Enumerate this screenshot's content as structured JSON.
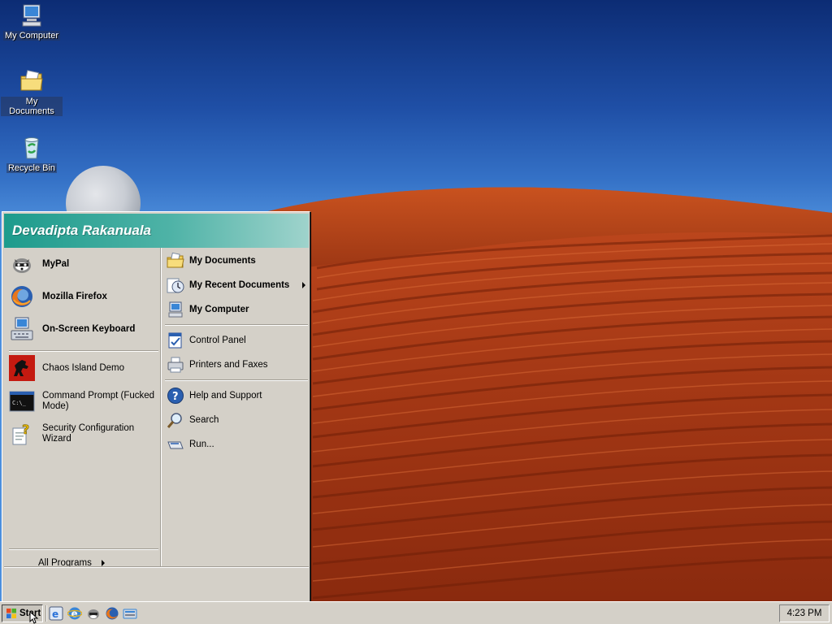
{
  "desktop": {
    "icons": [
      {
        "label": "My Computer",
        "icon": "my-computer-icon"
      },
      {
        "label": "My Documents",
        "icon": "my-documents-icon"
      },
      {
        "label": "Recycle Bin",
        "icon": "recycle-bin-icon"
      }
    ]
  },
  "start_menu": {
    "user_name": "Devadipta Rakanuala",
    "pinned": [
      {
        "label": "MyPal",
        "icon": "mypal-icon"
      },
      {
        "label": "Mozilla Firefox",
        "icon": "firefox-icon"
      },
      {
        "label": "On-Screen Keyboard",
        "icon": "on-screen-keyboard-icon"
      }
    ],
    "recent": [
      {
        "label": "Chaos Island Demo",
        "icon": "chaos-island-icon"
      },
      {
        "label": "Command Prompt (Fucked Mode)",
        "icon": "command-prompt-icon"
      },
      {
        "label": "Security Configuration Wizard",
        "icon": "security-wizard-icon"
      }
    ],
    "all_programs": "All Programs",
    "places": [
      {
        "label": "My Documents",
        "icon": "my-documents-icon"
      },
      {
        "label": "My Recent Documents",
        "icon": "recent-documents-icon"
      },
      {
        "label": "My Computer",
        "icon": "my-computer-icon"
      }
    ],
    "settings": [
      {
        "label": "Control Panel",
        "icon": "control-panel-icon"
      },
      {
        "label": "Printers and Faxes",
        "icon": "printers-icon"
      }
    ],
    "tools": [
      {
        "label": "Help and Support",
        "icon": "help-icon"
      },
      {
        "label": "Search",
        "icon": "search-icon"
      },
      {
        "label": "Run...",
        "icon": "run-icon"
      }
    ]
  },
  "taskbar": {
    "start_label": "Start",
    "quick_launch": [
      "ie-icon",
      "ie-icon",
      "mypal-icon",
      "firefox-icon",
      "keyboard-icon"
    ],
    "clock": "4:23 PM"
  },
  "colors": {
    "header_gradient_start": "#1d9b8c",
    "menu_face": "#d4d0c8",
    "dune": "#b8401c",
    "sky": "#2b5fb0"
  }
}
